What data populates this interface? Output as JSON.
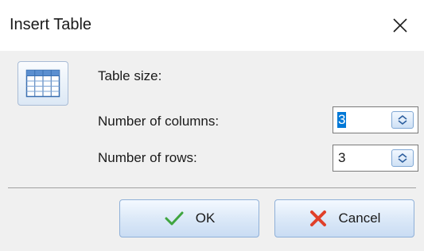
{
  "window": {
    "title": "Insert Table",
    "close_icon": "close-icon"
  },
  "form": {
    "icon": "table-grid-icon",
    "section_label": "Table size:",
    "columns": {
      "label": "Number of columns:",
      "value": "3",
      "selected": true
    },
    "rows": {
      "label": "Number of rows:",
      "value": "3",
      "selected": false
    }
  },
  "buttons": {
    "ok": {
      "label": "OK",
      "icon": "checkmark-icon",
      "icon_color": "#3fa53f"
    },
    "cancel": {
      "label": "Cancel",
      "icon": "x-cross-icon",
      "icon_color": "#e0402a"
    }
  },
  "colors": {
    "selection": "#0078d7",
    "button_border": "#8fb0d8"
  }
}
